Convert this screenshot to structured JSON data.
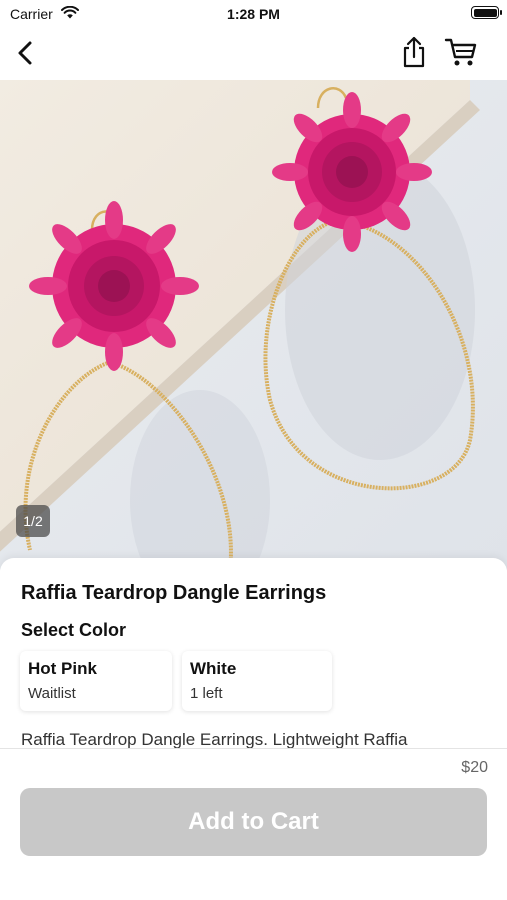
{
  "status_bar": {
    "carrier": "Carrier",
    "time": "1:28 PM",
    "icons": [
      "wifi-icon",
      "battery-icon"
    ]
  },
  "nav": {
    "icons": [
      "back-chevron-icon",
      "share-icon",
      "cart-icon"
    ]
  },
  "gallery": {
    "page_indicator": "1/2",
    "image_subject": "pink raffia flower earrings with gold teardrop hoops"
  },
  "product": {
    "title": "Raffia Teardrop Dangle Earrings",
    "select_color_label": "Select Color",
    "variants": [
      {
        "name": "Hot Pink",
        "stock": "Waitlist"
      },
      {
        "name": "White",
        "stock": "1 left"
      }
    ],
    "description": "Raffia Teardrop Dangle Earrings. Lightweight Raffia"
  },
  "footer": {
    "price": "$20",
    "add_to_cart_label": "Add to Cart"
  },
  "colors": {
    "accent_flower": "#e0287c",
    "button_disabled": "#c8c8c8",
    "gold": "#d8b060"
  }
}
